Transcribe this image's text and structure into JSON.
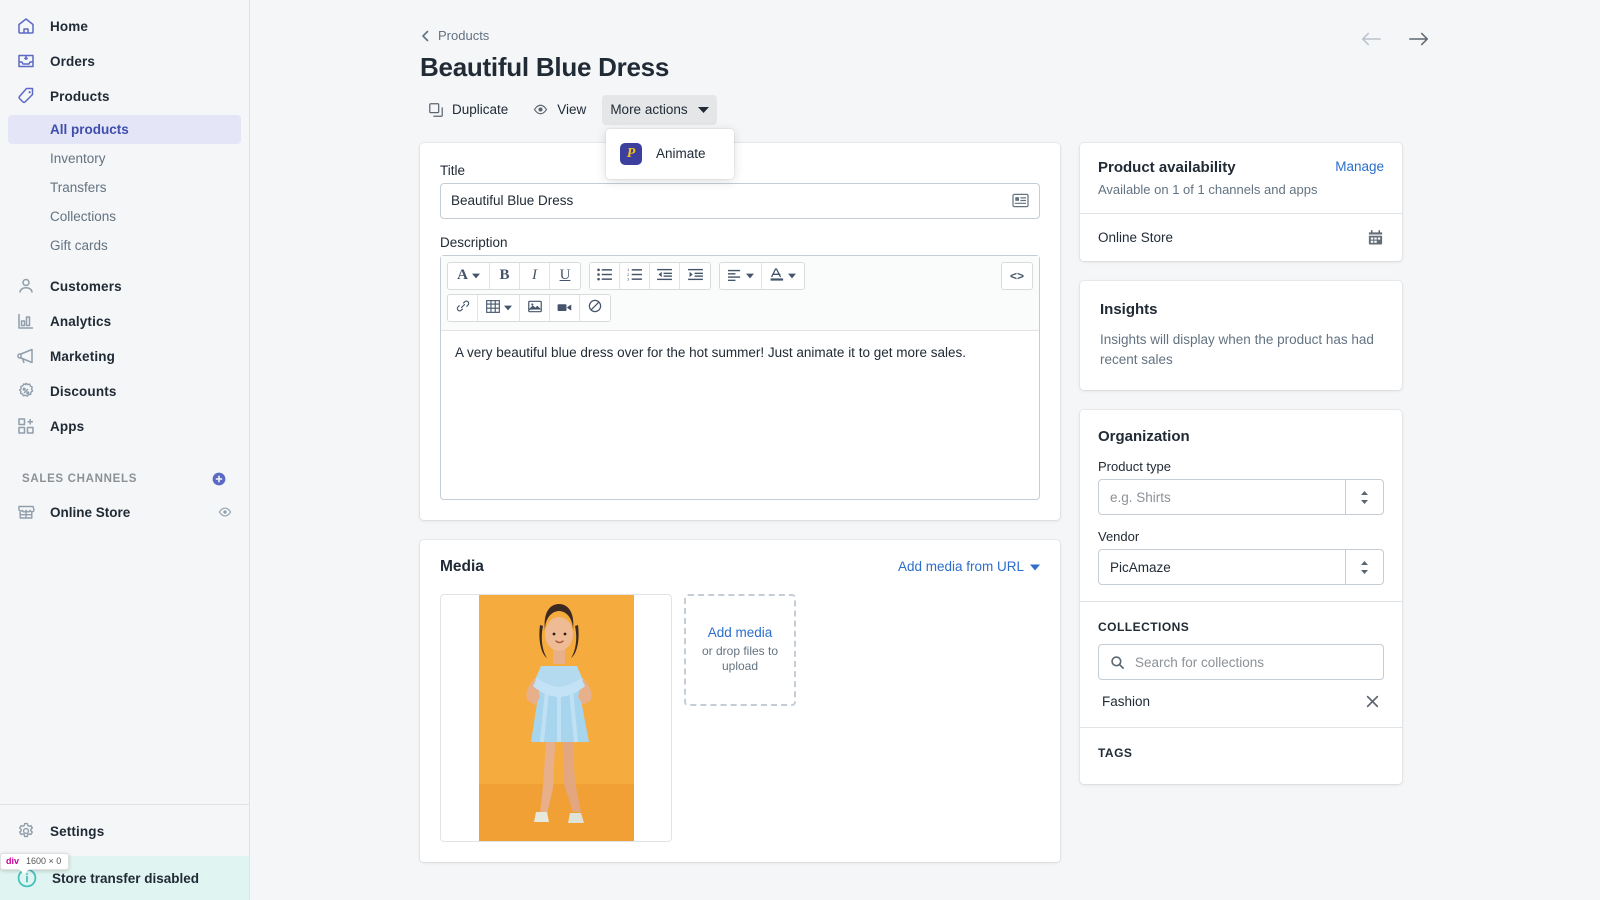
{
  "sidebar": {
    "main_items": [
      {
        "label": "Home",
        "icon": "home-icon"
      },
      {
        "label": "Orders",
        "icon": "orders-inbox-icon"
      },
      {
        "label": "Products",
        "icon": "products-tag-icon"
      }
    ],
    "product_subitems": [
      {
        "label": "All products",
        "active": true
      },
      {
        "label": "Inventory",
        "active": false
      },
      {
        "label": "Transfers",
        "active": false
      },
      {
        "label": "Collections",
        "active": false
      },
      {
        "label": "Gift cards",
        "active": false
      }
    ],
    "secondary_items": [
      {
        "label": "Customers",
        "icon": "customer-person-icon"
      },
      {
        "label": "Analytics",
        "icon": "analytics-bars-icon"
      },
      {
        "label": "Marketing",
        "icon": "marketing-megaphone-icon"
      },
      {
        "label": "Discounts",
        "icon": "discounts-percent-icon"
      },
      {
        "label": "Apps",
        "icon": "apps-grid-plus-icon"
      }
    ],
    "sales_channels_heading": "SALES CHANNELS",
    "add_channel_icon": "plus-circle-icon",
    "channels": [
      {
        "label": "Online Store",
        "icon": "storefront-icon",
        "action_icon": "eye-icon"
      }
    ],
    "settings": {
      "label": "Settings",
      "icon": "gear-icon"
    },
    "store_banner": {
      "label": "Store transfer disabled",
      "icon": "info-circle-icon"
    },
    "dev_badge": {
      "tag": "div",
      "dimensions": "1600 × 0"
    },
    "active_accent": "#5c6ac4"
  },
  "header": {
    "breadcrumb": "Products",
    "breadcrumb_icon": "chevron-left-icon",
    "title": "Beautiful Blue Dress",
    "actions": [
      {
        "label": "Duplicate",
        "icon": "duplicate-icon"
      },
      {
        "label": "View",
        "icon": "eye-icon"
      },
      {
        "label": "More actions",
        "icon": "chevron-down-icon"
      }
    ],
    "prev_icon": "arrow-left-icon",
    "next_icon": "arrow-right-icon"
  },
  "dropdown": {
    "items": [
      {
        "label": "Animate",
        "app_icon_letter": "P",
        "app_icon_bg": "#3c3f9e",
        "app_icon_fg": "#f5c518"
      }
    ]
  },
  "title_card": {
    "title_label": "Title",
    "title_value": "Beautiful Blue Dress",
    "title_tail_icon": "list-details-icon",
    "description_label": "Description",
    "description_value": "A very beautiful blue dress over for the hot summer! Just animate it to get more sales.",
    "toolbar_row1": [
      {
        "name": "font-family-button",
        "glyph": "A",
        "caret": true
      },
      {
        "name": "bold-button",
        "glyph": "B",
        "caret": false
      },
      {
        "name": "italic-button",
        "glyph": "I",
        "caret": false
      },
      {
        "name": "underline-button",
        "glyph": "U",
        "caret": false
      }
    ],
    "toolbar_row1b": [
      {
        "name": "bulleted-list-button",
        "icon": "bullet-list-icon"
      },
      {
        "name": "numbered-list-button",
        "icon": "numbered-list-icon"
      },
      {
        "name": "outdent-button",
        "icon": "outdent-icon"
      },
      {
        "name": "indent-button",
        "icon": "indent-icon"
      }
    ],
    "toolbar_row1c": [
      {
        "name": "align-button",
        "icon": "align-left-icon",
        "caret": true
      },
      {
        "name": "text-color-button",
        "icon": "text-color-icon",
        "caret": true
      }
    ],
    "toolbar_code": {
      "name": "html-code-button",
      "glyph": "<>"
    },
    "toolbar_row2": [
      {
        "name": "link-button",
        "icon": "link-icon"
      },
      {
        "name": "table-button",
        "icon": "table-icon",
        "caret": true
      },
      {
        "name": "insert-image-button",
        "icon": "image-icon"
      },
      {
        "name": "insert-video-button",
        "icon": "video-icon"
      },
      {
        "name": "clear-formatting-button",
        "icon": "no-entry-icon"
      }
    ]
  },
  "media_card": {
    "title": "Media",
    "add_from_url_label": "Add media from URL",
    "add_from_url_icon": "chevron-down-icon",
    "dropzone_link": "Add media",
    "dropzone_hint": "or drop files to upload",
    "thumbnail_alt": "woman-in-blue-dress-photo",
    "thumbnail_bg": "#f5a93c",
    "dress_color": "#a8d5ee"
  },
  "availability_card": {
    "title": "Product availability",
    "manage_label": "Manage",
    "subtitle": "Available on 1 of 1 channels and apps",
    "rows": [
      {
        "name": "Online Store",
        "icon": "calendar-icon"
      }
    ]
  },
  "insights_card": {
    "title": "Insights",
    "body": "Insights will display when the product has had recent sales"
  },
  "organization_card": {
    "title": "Organization",
    "product_type_label": "Product type",
    "product_type_placeholder": "e.g. Shirts",
    "product_type_value": "",
    "vendor_label": "Vendor",
    "vendor_value": "PicAmaze",
    "collections_heading": "COLLECTIONS",
    "collections_search_placeholder": "Search for collections",
    "collections_search_icon": "search-icon",
    "collections": [
      {
        "name": "Fashion",
        "remove_icon": "close-x-icon"
      }
    ],
    "tags_heading": "TAGS"
  }
}
